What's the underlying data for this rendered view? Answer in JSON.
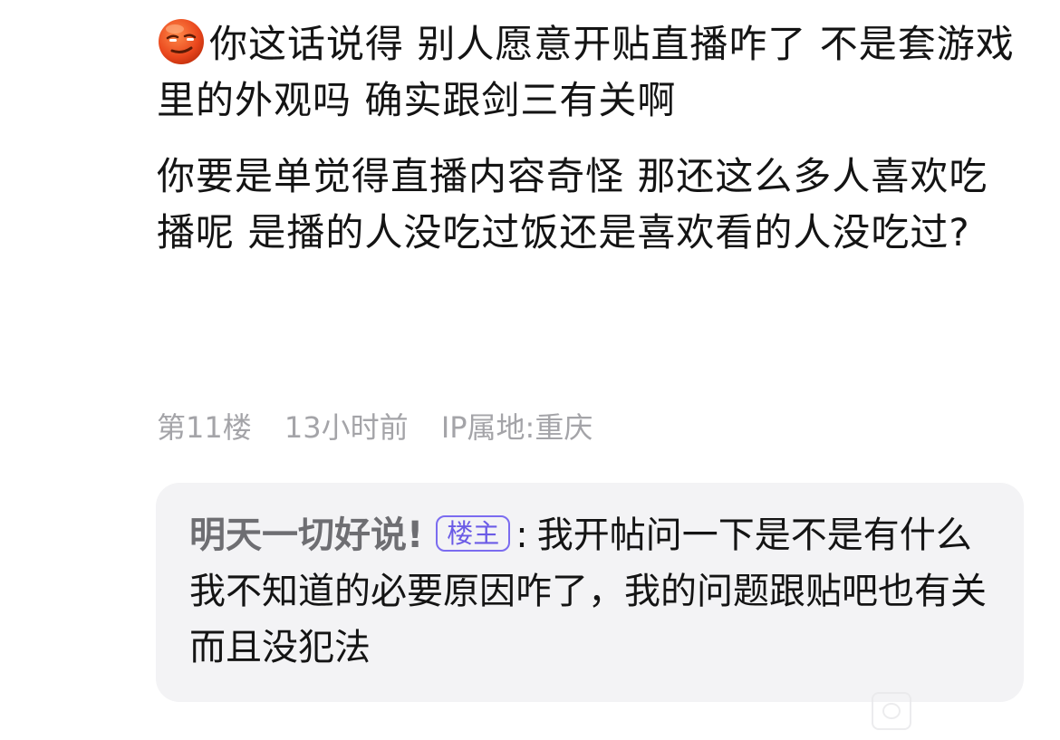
{
  "post": {
    "emoji": "smirk-face-emoji",
    "paragraph1_text": "你这话说得 别人愿意开贴直播咋了 不是套游戏里的外观吗 确实跟剑三有关啊",
    "paragraph2_text": "你要是单觉得直播内容奇怪 那还这么多人喜欢吃播呢 是播的人没吃过饭还是喜欢看的人没吃过?"
  },
  "meta": {
    "floor": "第11楼",
    "time": "13小时前",
    "ip_location": "IP属地:重庆"
  },
  "reply": {
    "author": "明天一切好说!",
    "badge": "楼主",
    "colon": ":",
    "text": "我开帖问一下是不是有什么我不知道的必要原因咋了，我的问题跟贴吧也有关 而且没犯法"
  },
  "colors": {
    "reply_bg": "#f3f3f5",
    "badge": "#6b5be6",
    "meta": "#a4a4a8"
  }
}
